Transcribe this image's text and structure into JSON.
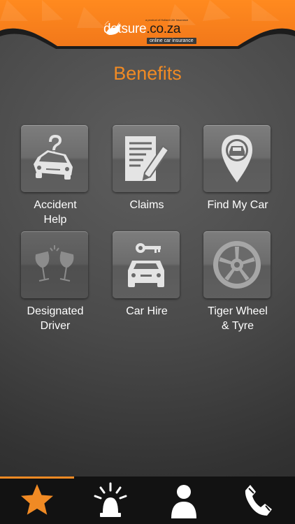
{
  "brand": {
    "name_main": "dotsure",
    "name_suffix": ".co.za",
    "tagline": "online car insurance",
    "small_print": "a product of Hollard Life Insurance"
  },
  "page": {
    "title": "Benefits"
  },
  "tiles": [
    {
      "label": "Accident\nHelp",
      "icon": "car-question-icon"
    },
    {
      "label": "Claims",
      "icon": "claim-form-icon"
    },
    {
      "label": "Find My Car",
      "icon": "car-location-pin-icon"
    },
    {
      "label": "Designated\nDriver",
      "icon": "wine-glasses-icon"
    },
    {
      "label": "Car Hire",
      "icon": "car-key-icon"
    },
    {
      "label": "Tiger Wheel\n& Tyre",
      "icon": "wheel-rim-icon"
    }
  ],
  "nav": {
    "items": [
      {
        "name": "benefits",
        "icon": "star-icon",
        "active": true
      },
      {
        "name": "emergency",
        "icon": "siren-icon",
        "active": false
      },
      {
        "name": "profile",
        "icon": "person-icon",
        "active": false
      },
      {
        "name": "call",
        "icon": "phone-icon",
        "active": false
      }
    ]
  },
  "colors": {
    "accent": "#f08a24",
    "navbar": "#121212",
    "tile": "#6c6c6c",
    "icon": "#e4e4e4"
  }
}
